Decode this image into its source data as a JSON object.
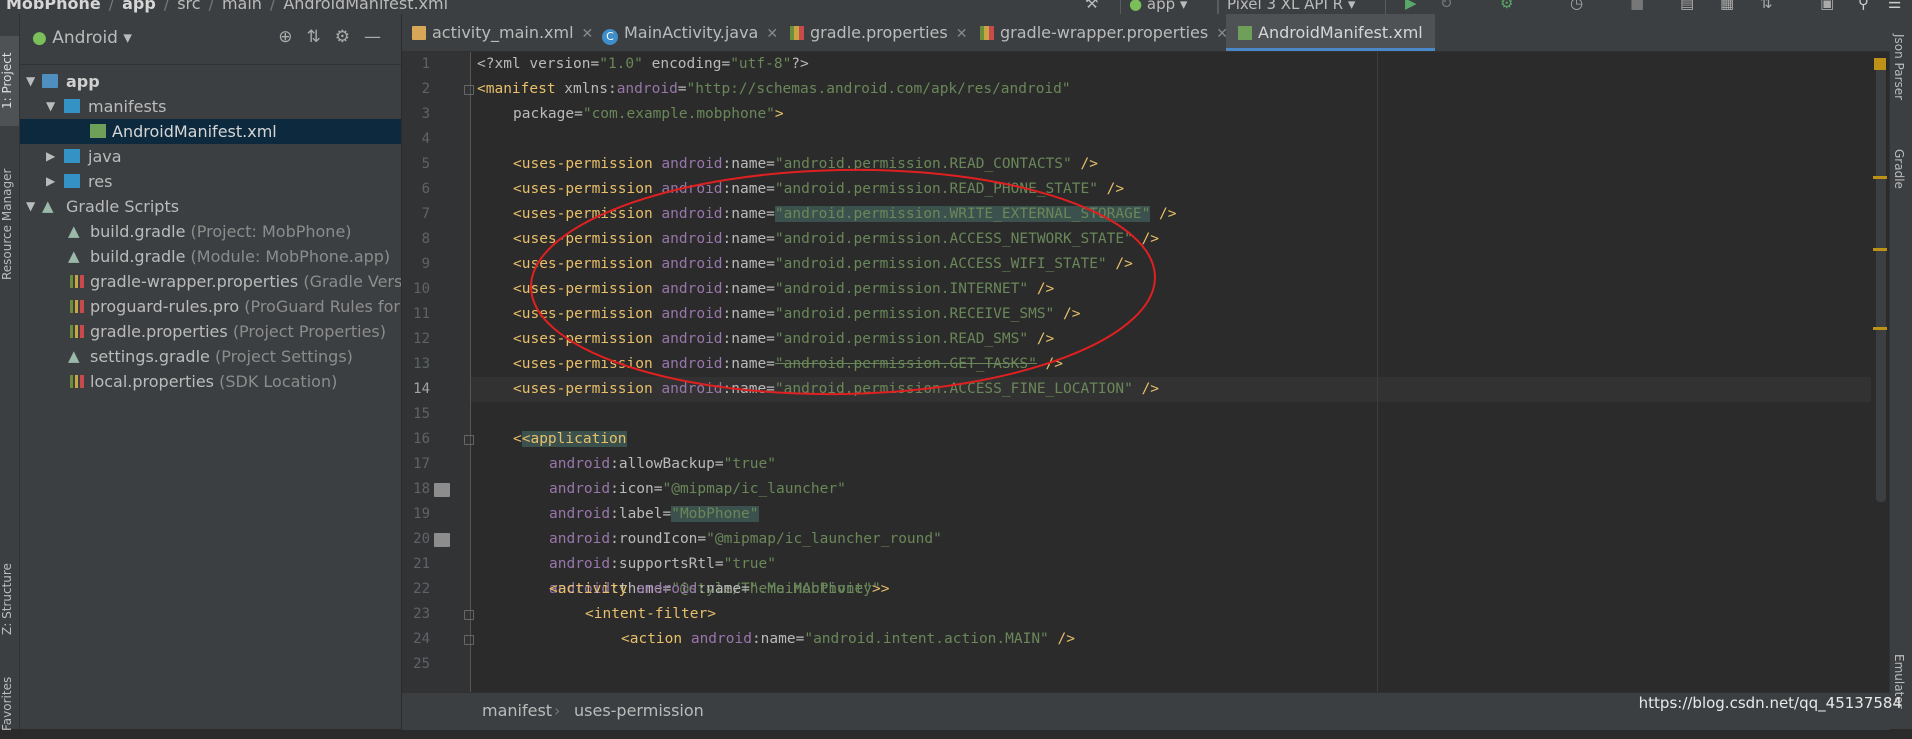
{
  "navbar": {
    "crumbs": [
      "MobPhone",
      "app",
      "src",
      "main",
      "AndroidManifest.xml"
    ],
    "run_config": "app",
    "device": "Pixel 3 XL API R"
  },
  "left_strip": {
    "tabs": [
      "1: Project",
      "Resource Manager",
      "Z: Structure",
      "Favorites"
    ]
  },
  "right_strip": {
    "tabs": [
      "Json Parser",
      "Gradle",
      "Emulator"
    ]
  },
  "project": {
    "view_selector": "Android",
    "tree": [
      {
        "label": "app",
        "hint": ""
      },
      {
        "label": "manifests",
        "hint": ""
      },
      {
        "label": "AndroidManifest.xml",
        "hint": ""
      },
      {
        "label": "java",
        "hint": ""
      },
      {
        "label": "res",
        "hint": ""
      },
      {
        "label": "Gradle Scripts",
        "hint": ""
      },
      {
        "label": "build.gradle",
        "hint": "(Project: MobPhone)"
      },
      {
        "label": "build.gradle",
        "hint": "(Module: MobPhone.app)"
      },
      {
        "label": "gradle-wrapper.properties",
        "hint": "(Gradle Version"
      },
      {
        "label": "proguard-rules.pro",
        "hint": "(ProGuard Rules for Mo"
      },
      {
        "label": "gradle.properties",
        "hint": "(Project Properties)"
      },
      {
        "label": "settings.gradle",
        "hint": "(Project Settings)"
      },
      {
        "label": "local.properties",
        "hint": "(SDK Location)"
      }
    ]
  },
  "tabs": [
    "activity_main.xml",
    "MainActivity.java",
    "gradle.properties",
    "gradle-wrapper.properties",
    "AndroidManifest.xml"
  ],
  "gutter": {
    "lines": [
      "1",
      "2",
      "3",
      "4",
      "5",
      "6",
      "7",
      "8",
      "9",
      "10",
      "11",
      "12",
      "13",
      "14",
      "15",
      "16",
      "17",
      "18",
      "19",
      "20",
      "21",
      "22",
      "23",
      "24",
      "25"
    ]
  },
  "code": {
    "l1": {
      "decl": "<?xml version=",
      "v1": "\"1.0\"",
      "mid": " encoding=",
      "v2": "\"utf-8\"",
      "end": "?>"
    },
    "l2": {
      "open": "<manifest",
      "ns": " xmlns:",
      "nsname": "android",
      "eq": "=",
      "val": "\"http://schemas.android.com/apk/res/android\""
    },
    "l3": {
      "attr": "package=",
      "val": "\"com.example.mobphone\"",
      "end": ">"
    },
    "perm_tag": "<uses-permission",
    "perm_ns": "android",
    "perm_attr": ":name=",
    "perm_close": " />",
    "permissions": [
      "\"android.permission.READ_CONTACTS\"",
      "\"android.permission.READ_PHONE_STATE\"",
      "\"android.permission.WRITE_EXTERNAL_STORAGE\"",
      "\"android.permission.ACCESS_NETWORK_STATE\"",
      "\"android.permission.ACCESS_WIFI_STATE\"",
      "\"android.permission.INTERNET\"",
      "\"android.permission.RECEIVE_SMS\"",
      "\"android.permission.READ_SMS\"",
      "\"android.permission.GET_TASKS\"",
      "\"android.permission.ACCESS_FINE_LOCATION\""
    ],
    "app_open": "<application",
    "app_attrs": [
      {
        "ns": "android",
        "name": ":allowBackup=",
        "val": "\"true\""
      },
      {
        "ns": "android",
        "name": ":icon=",
        "val": "\"@mipmap/ic_launcher\""
      },
      {
        "ns": "android",
        "name": ":label=",
        "val": "\"MobPhone\""
      },
      {
        "ns": "android",
        "name": ":roundIcon=",
        "val": "\"@mipmap/ic_launcher_round\""
      },
      {
        "ns": "android",
        "name": ":supportsRtl=",
        "val": "\"true\""
      },
      {
        "ns": "android",
        "name": ":theme=",
        "val": "\"@style/Theme.MobPhone\"",
        "end": ">"
      }
    ],
    "activity": {
      "tag": "<activity",
      "ns": " android",
      "name": ":name=",
      "val": "\".MainActivity\"",
      "end": ">"
    },
    "intent": "<intent-filter>",
    "action": {
      "tag": "<action",
      "ns": " android",
      "name": ":name=",
      "val": "\"android.intent.action.MAIN\"",
      "end": " />"
    }
  },
  "breadcrumb": [
    "manifest",
    "uses-permission"
  ],
  "watermark": "https://blog.csdn.net/qq_45137584"
}
